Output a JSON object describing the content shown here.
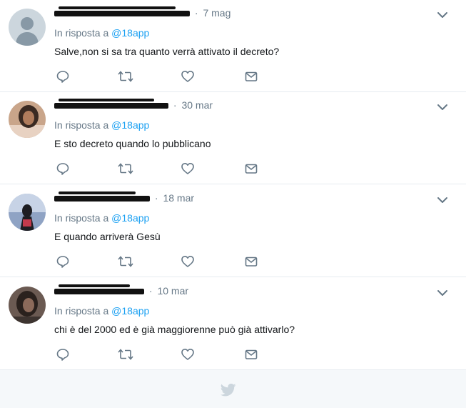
{
  "tweets": [
    {
      "date": "7 mag",
      "reply_prefix": "In risposta a",
      "reply_handle": "@18app",
      "text": "Salve,non si sa tra quanto verrà attivato il decreto?"
    },
    {
      "date": "30 mar",
      "reply_prefix": "In risposta a",
      "reply_handle": "@18app",
      "text": "E sto decreto quando lo pubblicano"
    },
    {
      "date": "18 mar",
      "reply_prefix": "In risposta a",
      "reply_handle": "@18app",
      "text": "E quando arriverà Gesù"
    },
    {
      "date": "10 mar",
      "reply_prefix": "In risposta a",
      "reply_handle": "@18app",
      "text": "chi è del 2000 ed è già maggiorenne può già attivarlo?"
    }
  ],
  "separator": "·",
  "icons": {
    "reply": "reply-icon",
    "retweet": "retweet-icon",
    "like": "like-icon",
    "message": "direct-message-icon",
    "more": "chevron-down-icon",
    "footer": "twitter-bird-icon"
  },
  "colors": {
    "link": "#1da1f2",
    "secondary_text": "#657786",
    "icon": "#657786",
    "border": "#e6ecf0",
    "footer_bg": "#f5f8fa",
    "footer_icon": "#ccd6dd"
  }
}
